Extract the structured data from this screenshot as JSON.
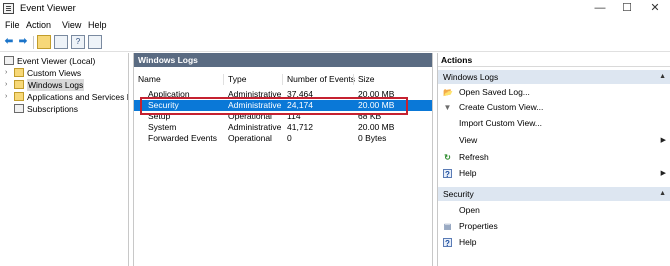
{
  "window": {
    "title": "Event Viewer",
    "minimize_glyph": "—",
    "maximize_glyph": "☐",
    "close_glyph": "✕"
  },
  "menu": [
    "File",
    "Action",
    "View",
    "Help"
  ],
  "toolbar": {
    "icons": [
      "back-arrow-icon",
      "forward-arrow-icon",
      "folder-up-icon",
      "console-tree-icon",
      "help-icon",
      "properties-icon"
    ],
    "back_glyph": "⬅",
    "forward_glyph": "➡",
    "help_glyph": "?"
  },
  "tree": {
    "root": "Event Viewer (Local)",
    "items": [
      "Custom Views",
      "Windows Logs",
      "Applications and Services Lo",
      "Subscriptions"
    ],
    "selected": "Windows Logs",
    "expander_glyph": "›"
  },
  "center": {
    "title": "Windows Logs",
    "columns": [
      "Name",
      "Type",
      "Number of Events",
      "Size"
    ],
    "rows": [
      {
        "name": "Application",
        "type": "Administrative",
        "events": "37,464",
        "size": "20.00 MB"
      },
      {
        "name": "Security",
        "type": "Administrative",
        "events": "24,174",
        "size": "20.00 MB"
      },
      {
        "name": "Setup",
        "type": "Operational",
        "events": "114",
        "size": "68 KB"
      },
      {
        "name": "System",
        "type": "Administrative",
        "events": "41,712",
        "size": "20.00 MB"
      },
      {
        "name": "Forwarded Events",
        "type": "Operational",
        "events": "0",
        "size": "0 Bytes"
      }
    ],
    "selected_row": "Security"
  },
  "actions": {
    "header": "Actions",
    "section_caret": "▲",
    "submenu_glyph": "▶",
    "section1": {
      "title": "Windows Logs",
      "items": [
        {
          "label": "Open Saved Log...",
          "icon": "open-folder-icon",
          "glyph": "📂"
        },
        {
          "label": "Create Custom View...",
          "icon": "filter-icon",
          "glyph": "▼"
        },
        {
          "label": "Import Custom View...",
          "icon": "",
          "glyph": ""
        },
        {
          "label": "View",
          "icon": "",
          "glyph": "",
          "submenu": true
        },
        {
          "label": "Refresh",
          "icon": "refresh-icon",
          "glyph": "↻"
        },
        {
          "label": "Help",
          "icon": "help-icon",
          "glyph": "?",
          "submenu": true
        }
      ]
    },
    "section2": {
      "title": "Security",
      "items": [
        {
          "label": "Open",
          "icon": "",
          "glyph": ""
        },
        {
          "label": "Properties",
          "icon": "properties-icon",
          "glyph": "▤"
        },
        {
          "label": "Help",
          "icon": "help-icon",
          "glyph": "?"
        }
      ]
    }
  },
  "colors": {
    "selection": "#0a78d7",
    "highlight_box": "#c52130",
    "panel_title_bg": "#5a6b82",
    "action_section_bg": "#dde6f1"
  }
}
